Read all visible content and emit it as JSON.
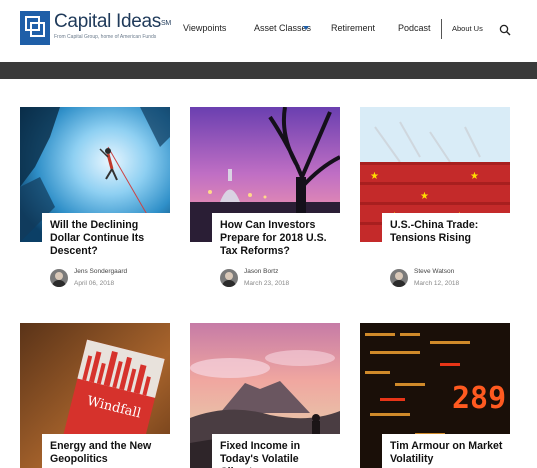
{
  "brand": {
    "name": "Capital Ideas",
    "trademark": "SM",
    "tagline": "From Capital Group, home of American Funds"
  },
  "nav": {
    "items": [
      "Viewpoints",
      "Asset Classes",
      "Retirement",
      "Podcast"
    ],
    "about": "About Us"
  },
  "articles": [
    {
      "title": "Will the Declining Dollar Continue Its Descent?",
      "author": "Jens Sondergaard",
      "date": "April 06, 2018",
      "image": "ice-cave-climber"
    },
    {
      "title": "How Can Investors Prepare for 2018 U.S. Tax Reforms?",
      "author": "Jason Bortz",
      "date": "March 23, 2018",
      "image": "capitol-dusk-tree"
    },
    {
      "title": "U.S.-China Trade: Tensions Rising",
      "author": "Steve Watson",
      "date": "March 12, 2018",
      "image": "china-shipping-containers"
    },
    {
      "title": "Energy and the New Geopolitics",
      "image": "windfall-book"
    },
    {
      "title": "Fixed Income in Today's Volatile Climate",
      "image": "volcano-sunrise"
    },
    {
      "title": "Tim Armour on Market Volatility",
      "image": "market-ticker-board"
    }
  ],
  "book_cover_text": "Windfall",
  "ticker_text": "289",
  "colors": {
    "brand_blue": "#1f5fa8",
    "band": "#3a3a3a"
  }
}
